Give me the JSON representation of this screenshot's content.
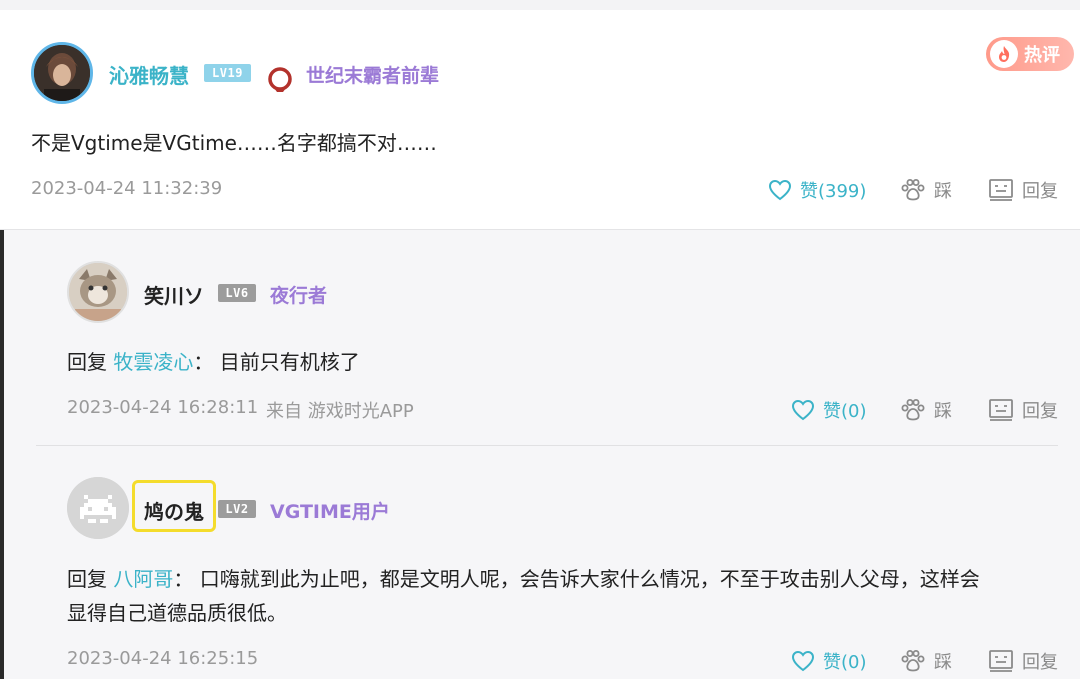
{
  "hot_badge": {
    "label": "热评"
  },
  "main_comment": {
    "username": "沁雅畅慧",
    "level": "LV19",
    "title": "世纪末霸者前辈",
    "content": "不是Vgtime是VGtime……名字都搞不对……",
    "timestamp": "2023-04-24 11:32:39",
    "like_label": "赞(399)",
    "dislike_label": "踩",
    "reply_label": "回复"
  },
  "replies": [
    {
      "username": "笑川ソ",
      "level": "LV6",
      "title": "夜行者",
      "reply_prefix": "回复",
      "reply_to": "牧雲凌心",
      "separator": "：",
      "content": "目前只有机核了",
      "timestamp": "2023-04-24 16:28:11",
      "source": "来自 游戏时光APP",
      "like_label": "赞(0)",
      "dislike_label": "踩",
      "reply_label": "回复"
    },
    {
      "username": "鸠の鬼",
      "level": "LV2",
      "title": "VGTIME用户",
      "reply_prefix": "回复",
      "reply_to": "八阿哥",
      "separator": "：",
      "content_line1": "口嗨就到此为止吧，都是文明人呢，会告诉大家什么情况，不至于攻击别人父母，这样会",
      "content_line2": "显得自己道德品质很低。",
      "timestamp": "2023-04-24 16:25:15",
      "like_label": "赞(0)",
      "dislike_label": "踩",
      "reply_label": "回复"
    }
  ],
  "colors": {
    "accent_cyan": "#3bb3c8",
    "title_purple": "#9b7ad6",
    "highlight_yellow": "#f4dc2c",
    "hot_badge": "#ff9a8a"
  },
  "icons": [
    "flame-icon",
    "heart-icon",
    "paw-icon",
    "reply-icon",
    "mask-icon",
    "space-invader-icon"
  ]
}
